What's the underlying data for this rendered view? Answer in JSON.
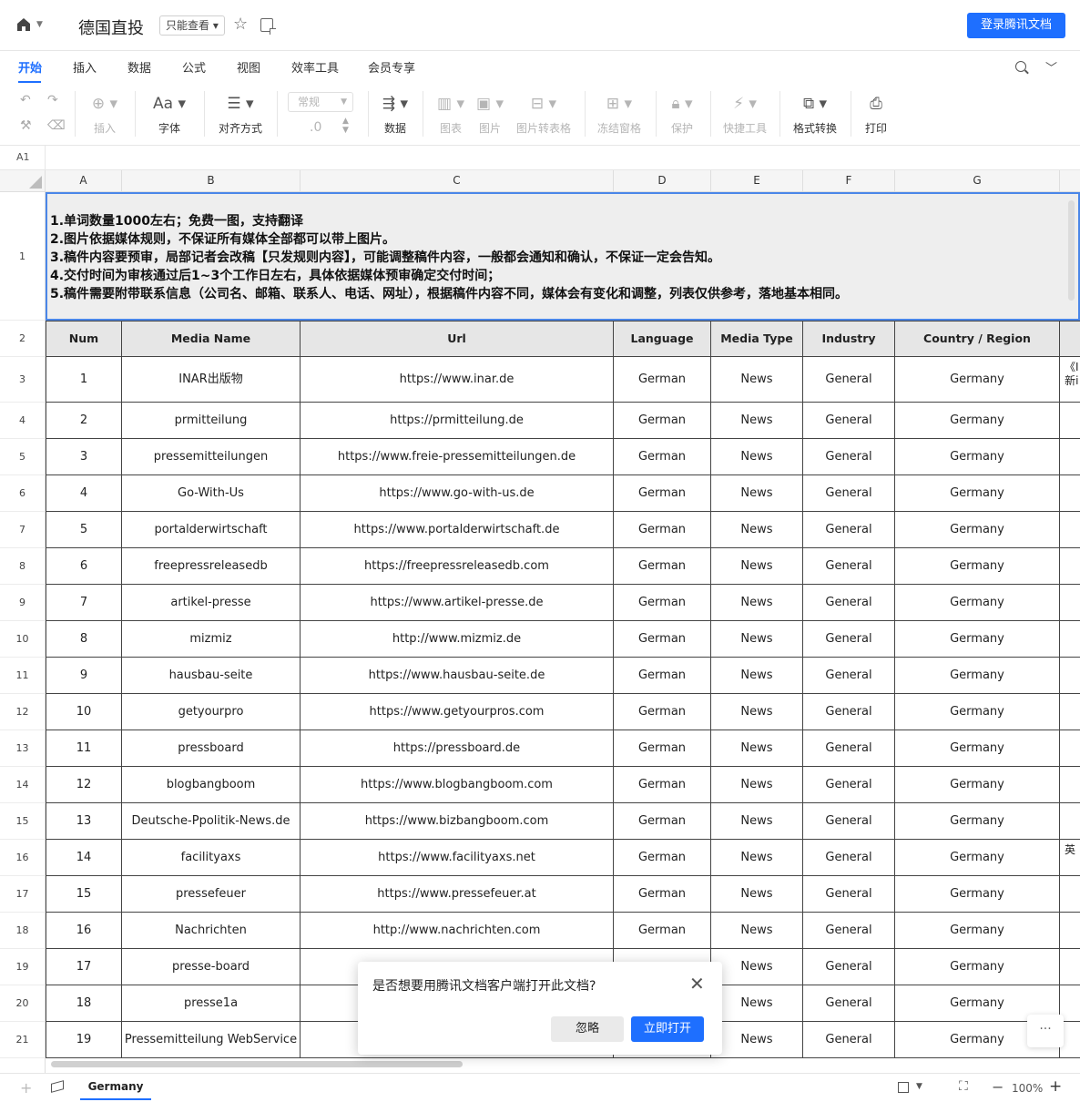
{
  "doc": {
    "title": "德国直投",
    "readonly_label": "只能查看",
    "login_label": "登录腾讯文档"
  },
  "tabs": [
    "开始",
    "插入",
    "数据",
    "公式",
    "视图",
    "效率工具",
    "会员专享"
  ],
  "toolbar": {
    "insert": "插入",
    "font": "字体",
    "align": "对齐方式",
    "format_value": "常规",
    "decimal": ".0",
    "data": "数据",
    "chart": "图表",
    "image": "图片",
    "img2table": "图片转表格",
    "freeze": "冻结窗格",
    "protect": "保护",
    "quick": "快捷工具",
    "convert": "格式转换",
    "print": "打印"
  },
  "formula_bar": {
    "cell_ref": "A1"
  },
  "columns": [
    "A",
    "B",
    "C",
    "D",
    "E",
    "F",
    "G"
  ],
  "notice_lines": [
    "1.单词数量1000左右；免费一图，支持翻译",
    "2.图片依据媒体规则，不保证所有媒体全部都可以带上图片。",
    "3.稿件内容要预审，局部记者会改稿【只发规则内容】，可能调整稿件内容，一般都会通知和确认，不保证一定会告知。",
    "4.交付时间为审核通过后1~3个工作日左右，具体依据媒体预审确定交付时间；",
    "5.稿件需要附带联系信息（公司名、邮箱、联系人、电话、网址），根据稿件内容不同，媒体会有变化和调整，列表仅供参考，落地基本相同。"
  ],
  "table": {
    "headers": [
      "Num",
      "Media Name",
      "Url",
      "Language",
      "Media Type",
      "Industry",
      "Country / Region"
    ],
    "rows": [
      {
        "num": "1",
        "name": "INAR出版物",
        "url": "https://www.inar.de",
        "lang": "German",
        "type": "News",
        "ind": "General",
        "country": "Germany",
        "h_extra": "《I\n新i"
      },
      {
        "num": "2",
        "name": "prmitteilung",
        "url": "https://prmitteilung.de",
        "lang": "German",
        "type": "News",
        "ind": "General",
        "country": "Germany",
        "h_extra": ""
      },
      {
        "num": "3",
        "name": "pressemitteilungen",
        "url": "https://www.freie-pressemitteilungen.de",
        "lang": "German",
        "type": "News",
        "ind": "General",
        "country": "Germany",
        "h_extra": ""
      },
      {
        "num": "4",
        "name": "Go-With-Us",
        "url": "https://www.go-with-us.de",
        "lang": "German",
        "type": "News",
        "ind": "General",
        "country": "Germany",
        "h_extra": ""
      },
      {
        "num": "5",
        "name": "portalderwirtschaft",
        "url": "https://www.portalderwirtschaft.de",
        "lang": "German",
        "type": "News",
        "ind": "General",
        "country": "Germany",
        "h_extra": ""
      },
      {
        "num": "6",
        "name": "freepressreleasedb",
        "url": "https://freepressreleasedb.com",
        "lang": "German",
        "type": "News",
        "ind": "General",
        "country": "Germany",
        "h_extra": ""
      },
      {
        "num": "7",
        "name": "artikel-presse",
        "url": "https://www.artikel-presse.de",
        "lang": "German",
        "type": "News",
        "ind": "General",
        "country": "Germany",
        "h_extra": ""
      },
      {
        "num": "8",
        "name": "mizmiz",
        "url": "http://www.mizmiz.de",
        "lang": "German",
        "type": "News",
        "ind": "General",
        "country": "Germany",
        "h_extra": ""
      },
      {
        "num": "9",
        "name": "hausbau-seite",
        "url": "https://www.hausbau-seite.de",
        "lang": "German",
        "type": "News",
        "ind": "General",
        "country": "Germany",
        "h_extra": ""
      },
      {
        "num": "10",
        "name": "getyourpro",
        "url": "https://www.getyourpros.com",
        "lang": "German",
        "type": "News",
        "ind": "General",
        "country": "Germany",
        "h_extra": ""
      },
      {
        "num": "11",
        "name": "pressboard",
        "url": "https://pressboard.de",
        "lang": "German",
        "type": "News",
        "ind": "General",
        "country": "Germany",
        "h_extra": ""
      },
      {
        "num": "12",
        "name": "blogbangboom",
        "url": "https://www.blogbangboom.com",
        "lang": "German",
        "type": "News",
        "ind": "General",
        "country": "Germany",
        "h_extra": ""
      },
      {
        "num": "13",
        "name": "Deutsche-Ppolitik-News.de",
        "url": "https://www.bizbangboom.com",
        "lang": "German",
        "type": "News",
        "ind": "General",
        "country": "Germany",
        "h_extra": ""
      },
      {
        "num": "14",
        "name": "facilityaxs",
        "url": "https://www.facilityaxs.net",
        "lang": "German",
        "type": "News",
        "ind": "General",
        "country": "Germany",
        "h_extra": "英"
      },
      {
        "num": "15",
        "name": "pressefeuer",
        "url": "https://www.pressefeuer.at",
        "lang": "German",
        "type": "News",
        "ind": "General",
        "country": "Germany",
        "h_extra": ""
      },
      {
        "num": "16",
        "name": "Nachrichten",
        "url": "http://www.nachrichten.com",
        "lang": "German",
        "type": "News",
        "ind": "General",
        "country": "Germany",
        "h_extra": ""
      },
      {
        "num": "17",
        "name": "presse-board",
        "url": "",
        "lang": "",
        "type": "News",
        "ind": "General",
        "country": "Germany",
        "h_extra": ""
      },
      {
        "num": "18",
        "name": "presse1a",
        "url": "",
        "lang": "",
        "type": "News",
        "ind": "General",
        "country": "Germany",
        "h_extra": ""
      },
      {
        "num": "19",
        "name": "Pressemitteilung WebService",
        "url": "",
        "lang": "",
        "type": "News",
        "ind": "General",
        "country": "Germany",
        "h_extra": ""
      }
    ]
  },
  "dialog": {
    "message": "是否想要用腾讯文档客户端打开此文档?",
    "ignore": "忽略",
    "open": "立即打开"
  },
  "more_label": "···",
  "status": {
    "sheet": "Germany",
    "zoom": "100%"
  }
}
